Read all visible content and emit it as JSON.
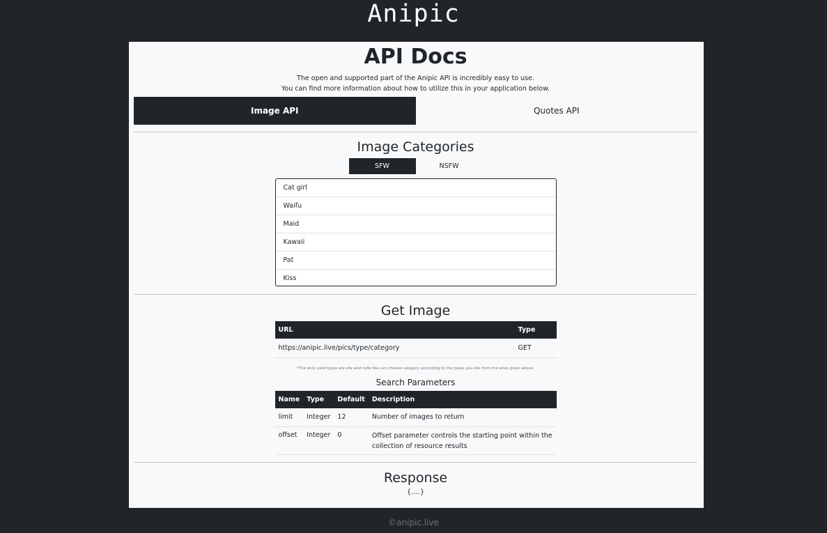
{
  "site": {
    "title": "Anipic",
    "footer": "©anipic.live"
  },
  "docs": {
    "title": "API Docs",
    "intro_line1": "The open and supported part of the Anipic API is incredibly easy to use.",
    "intro_line2": "You can find more information about how to utilize this in your application below.",
    "tabs": [
      {
        "label": "Image API",
        "active": true
      },
      {
        "label": "Quotes API",
        "active": false
      }
    ]
  },
  "categories": {
    "title": "Image Categories",
    "tabs": [
      {
        "label": "SFW",
        "active": true
      },
      {
        "label": "NSFW",
        "active": false
      }
    ],
    "items": [
      "Cat girl",
      "Waifu",
      "Maid",
      "Kawaii",
      "Pat",
      "Kiss"
    ]
  },
  "get_image": {
    "title": "Get Image",
    "headers": {
      "url": "URL",
      "type": "Type"
    },
    "row": {
      "url": "https://anipic.live/pics/type/category",
      "type": "GET"
    },
    "note": "*The only valid types are sfw and nsfw.You can choose category according to the types you like from the ones given above."
  },
  "search_params": {
    "title": "Search Parameters",
    "headers": {
      "name": "Name",
      "type": "Type",
      "default": "Default",
      "description": "Description"
    },
    "rows": [
      {
        "name": "limit",
        "type": "Integer",
        "default": "12",
        "description": "Number of images to return"
      },
      {
        "name": "offset",
        "type": "Integer",
        "default": "0",
        "description": "Offset parameter controls the starting point within the collection of resource results"
      }
    ]
  },
  "response": {
    "title": "Response",
    "body": "{....}"
  }
}
